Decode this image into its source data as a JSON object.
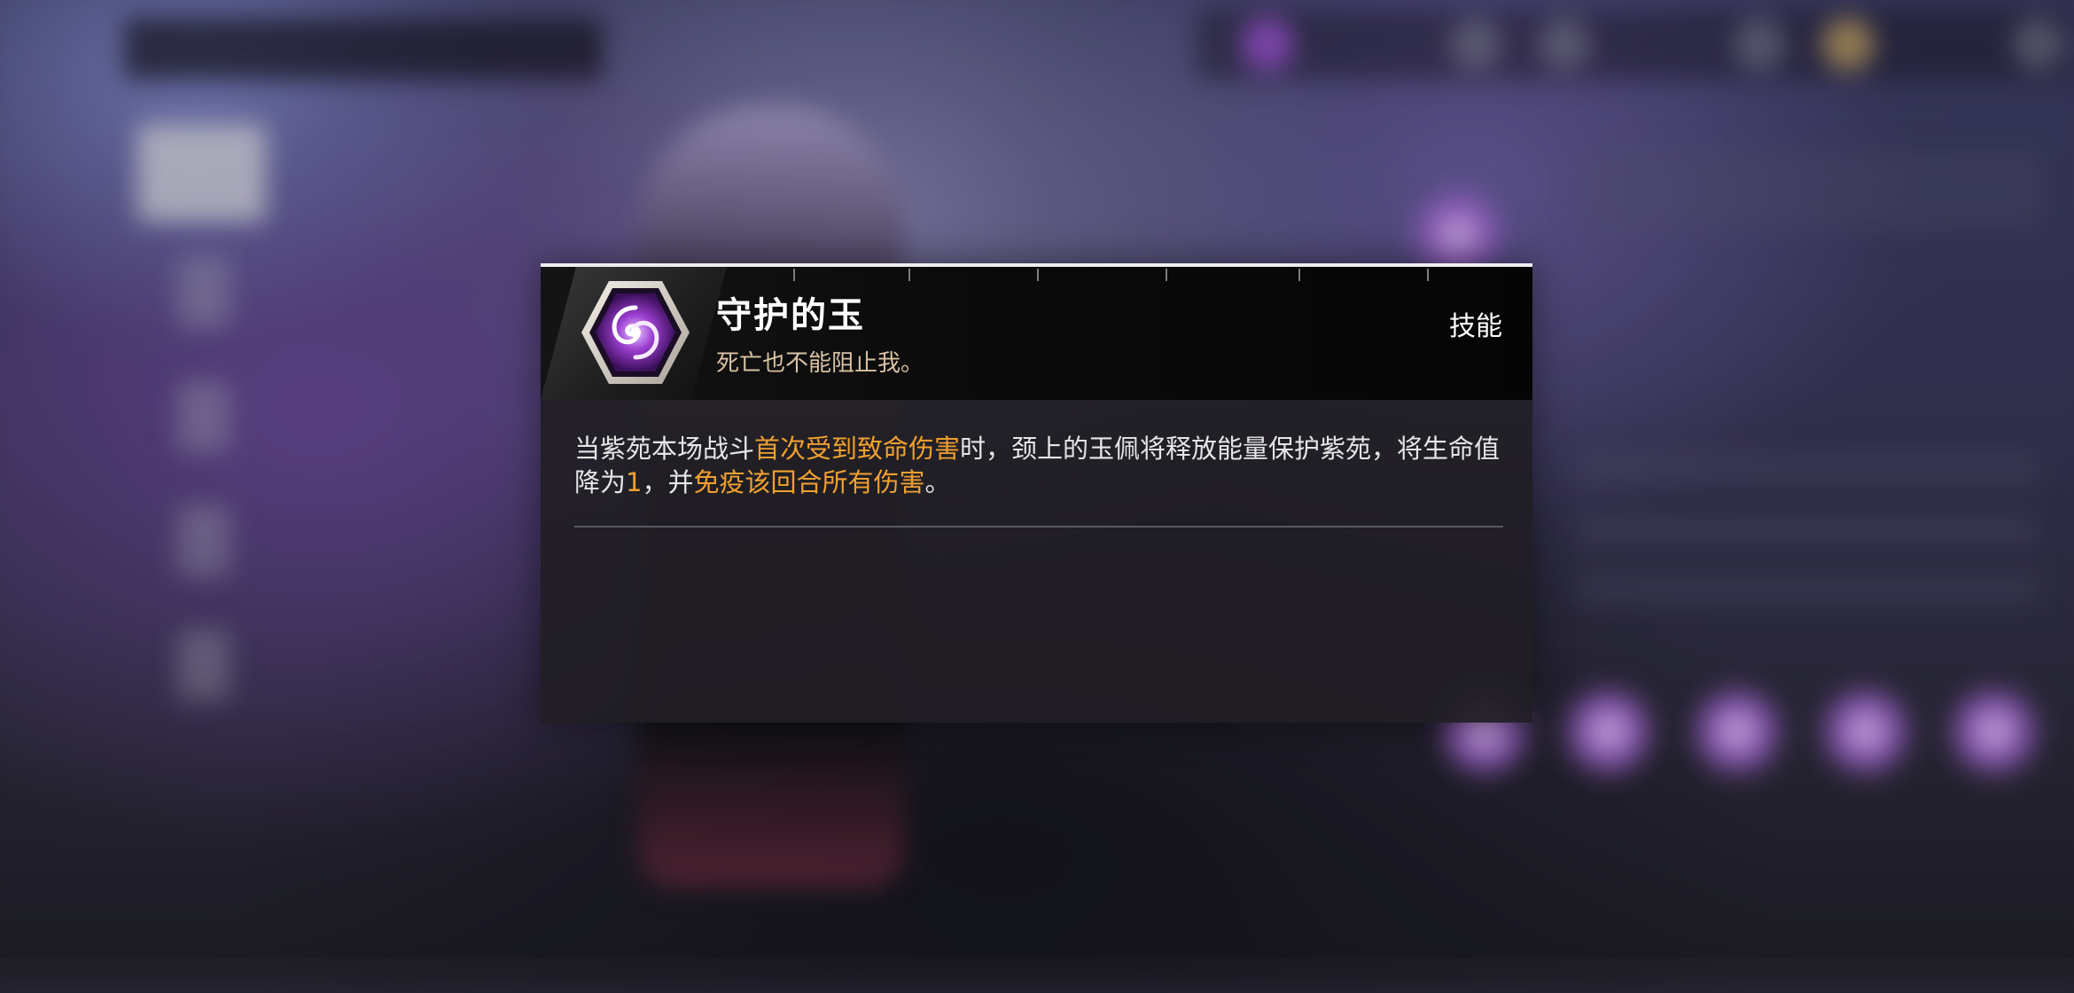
{
  "skill_popup": {
    "title": "守护的玉",
    "quote": "死亡也不能阻止我。",
    "tag": "技能",
    "description": {
      "p1": "当紫苑本场战斗",
      "hl1": "首次受到致命伤害",
      "p2": "时，颈上的玉佩将释放能量保护紫苑，将生命值降为",
      "hl2": "1",
      "p3": "，并",
      "hl3": "免疫该回合所有伤害",
      "p4": "。"
    },
    "icon": "purple-swirl-hexagon-icon"
  },
  "colors": {
    "highlight": "#f0a030",
    "quote": "#d8c2a2",
    "icon_purple": "#9b3fd0"
  }
}
